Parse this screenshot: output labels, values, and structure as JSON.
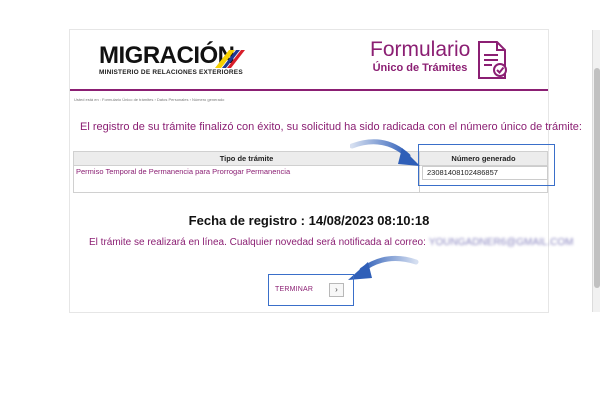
{
  "header": {
    "logo_word": "MIGRACIÓN",
    "logo_subtitle": "MINISTERIO DE RELACIONES EXTERIORES",
    "form_title_line1": "Formulario",
    "form_title_line2": "Único de Trámites"
  },
  "breadcrumb": "Usted está en : Formulario Único de trámites › Datos Personales › Número generado",
  "success_message": "El registro de su trámite finalizó con éxito, su solicitud ha sido radicada con el número único de trámite:",
  "table": {
    "header_tipo": "Tipo de trámite",
    "header_numero": "Número generado",
    "row_tipo": "Permiso Temporal de Permanencia para Prorrogar Permanencia",
    "row_numero": "23081408102486857"
  },
  "registration": {
    "date_label": "Fecha de registro :",
    "date_value": "14/08/2023 08:10:18"
  },
  "online_notice": {
    "text": "El trámite se realizará en línea. Cualquier novedad será notificada al correo:",
    "email": "YOUNGADNER6@GMAIL.COM"
  },
  "button": {
    "label": "TERMINAR",
    "icon": "chevron-right-icon"
  },
  "colors": {
    "brand_purple": "#8b1f73",
    "highlight_blue": "#3a6fc9"
  }
}
